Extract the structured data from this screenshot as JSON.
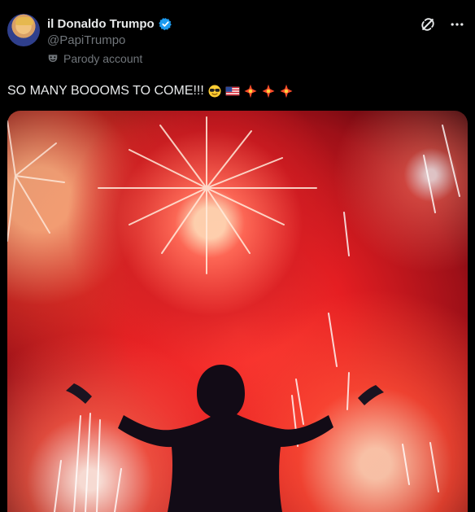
{
  "header": {
    "display_name": "il Donaldo Trumpo",
    "handle": "@PapiTrumpo",
    "parody_label": "Parody account",
    "icons": [
      "verified-badge-icon",
      "grok-icon",
      "more-icon",
      "parody-mask-icon"
    ]
  },
  "post": {
    "text": "SO MANY BOOOMS TO COME!!!",
    "emojis": [
      "sunglasses-face",
      "us-flag",
      "sparkle-burst",
      "sparkle-burst",
      "sparkle-burst"
    ]
  },
  "colors": {
    "background": "#000000",
    "text": "#e7e9ea",
    "muted": "#71767b",
    "verified": "#1d9bf0",
    "fireworks": "#ff3a32"
  }
}
